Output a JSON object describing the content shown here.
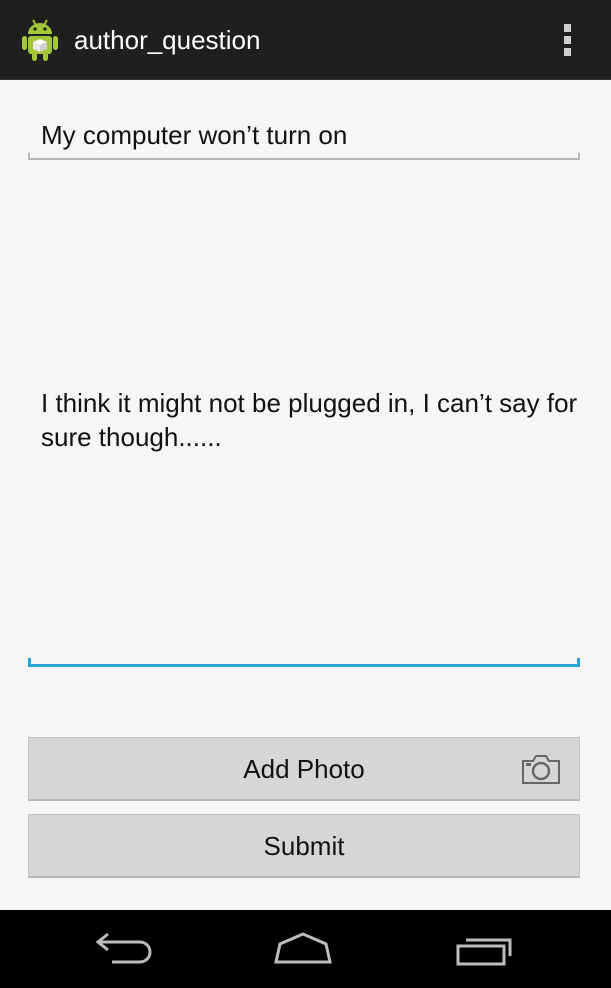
{
  "action_bar": {
    "title": "author_question",
    "app_icon": "android-icon",
    "overflow_icon": "overflow-menu-icon"
  },
  "form": {
    "title_value": "My computer won’t turn on",
    "body_value": "I think it might not be plugged in, I can’t say for sure though......"
  },
  "buttons": {
    "add_photo_label": "Add Photo",
    "add_photo_icon": "camera-icon",
    "submit_label": "Submit"
  },
  "nav_bar": {
    "back_icon": "back-icon",
    "home_icon": "home-icon",
    "recent_icon": "recent-apps-icon"
  },
  "colors": {
    "action_bar_bg": "#1f1f1f",
    "focus_underline": "#2aa3d8",
    "button_bg": "#d6d6d6",
    "android_green": "#a4c639"
  }
}
